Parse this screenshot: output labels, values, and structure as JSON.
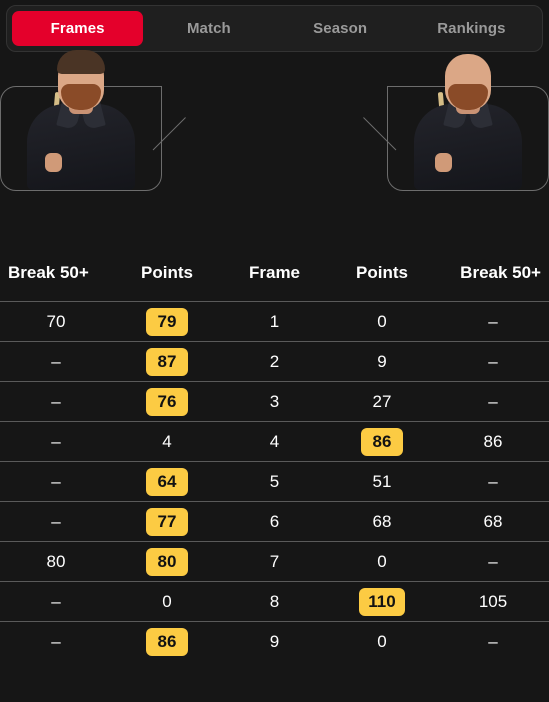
{
  "tabs": [
    {
      "label": "Frames",
      "active": true
    },
    {
      "label": "Match",
      "active": false
    },
    {
      "label": "Season",
      "active": false
    },
    {
      "label": "Rankings",
      "active": false
    }
  ],
  "players": {
    "left": {
      "hair": "short-brown",
      "cue_side": "right"
    },
    "right": {
      "hair": "bald",
      "cue_side": "left"
    }
  },
  "table": {
    "headers": [
      "Break 50+",
      "Points",
      "Frame",
      "Points",
      "Break 50+"
    ],
    "rows": [
      {
        "break1": "70",
        "points1": "79",
        "points1_hl": true,
        "frame": "1",
        "points2": "0",
        "points2_hl": false,
        "break2": "–"
      },
      {
        "break1": "–",
        "points1": "87",
        "points1_hl": true,
        "frame": "2",
        "points2": "9",
        "points2_hl": false,
        "break2": "–"
      },
      {
        "break1": "–",
        "points1": "76",
        "points1_hl": true,
        "frame": "3",
        "points2": "27",
        "points2_hl": false,
        "break2": "–"
      },
      {
        "break1": "–",
        "points1": "4",
        "points1_hl": false,
        "frame": "4",
        "points2": "86",
        "points2_hl": true,
        "break2": "86"
      },
      {
        "break1": "–",
        "points1": "64",
        "points1_hl": true,
        "frame": "5",
        "points2": "51",
        "points2_hl": false,
        "break2": "–"
      },
      {
        "break1": "–",
        "points1": "77",
        "points1_hl": true,
        "frame": "6",
        "points2": "68",
        "points2_hl": false,
        "break2": "68"
      },
      {
        "break1": "80",
        "points1": "80",
        "points1_hl": true,
        "frame": "7",
        "points2": "0",
        "points2_hl": false,
        "break2": "–"
      },
      {
        "break1": "–",
        "points1": "0",
        "points1_hl": false,
        "frame": "8",
        "points2": "110",
        "points2_hl": true,
        "break2": "105"
      },
      {
        "break1": "–",
        "points1": "86",
        "points1_hl": true,
        "frame": "9",
        "points2": "0",
        "points2_hl": false,
        "break2": "–"
      }
    ]
  },
  "colors": {
    "background": "#161616",
    "active_tab": "#e4002b",
    "badge": "#fccb43",
    "badge_text": "#121212",
    "row_divider": "#5a5a5a",
    "inactive_tab_text": "#9a9a9a"
  }
}
